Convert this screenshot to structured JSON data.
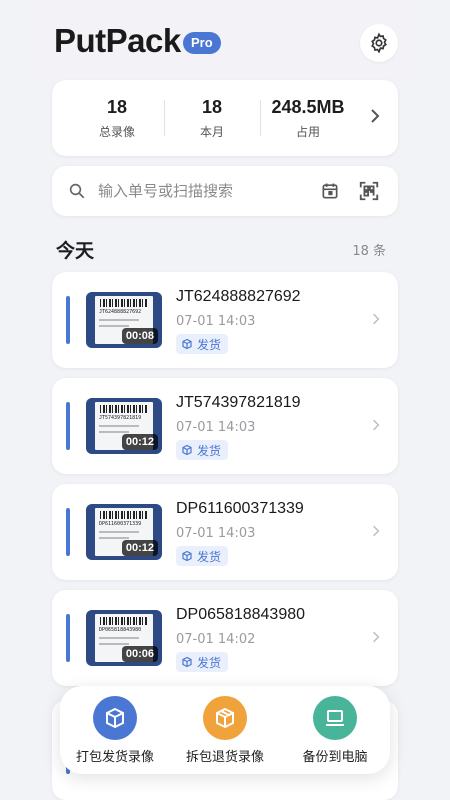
{
  "app": {
    "title": "PutPack",
    "badge": "Pro"
  },
  "icons": {
    "settings": "gear-icon",
    "search": "search-icon",
    "calendar": "calendar-icon",
    "scan": "scan-icon",
    "chevron": "chevron-right-icon",
    "tag": "box-icon"
  },
  "colors": {
    "accent": "#4a76d4",
    "orange": "#f0a23b",
    "teal": "#48b49a"
  },
  "stats": [
    {
      "value": "18",
      "label": "总录像"
    },
    {
      "value": "18",
      "label": "本月"
    },
    {
      "value": "248.5MB",
      "label": "占用"
    }
  ],
  "search": {
    "placeholder": "输入单号或扫描搜索"
  },
  "section": {
    "title": "今天",
    "count": "18 条"
  },
  "records": [
    {
      "tracking": "JT624888827692",
      "datetime": "07-01 14:03",
      "tag": "发货",
      "duration": "00:08",
      "thumb_text": "JT624888827692"
    },
    {
      "tracking": "JT574397821819",
      "datetime": "07-01 14:03",
      "tag": "发货",
      "duration": "00:12",
      "thumb_text": "JT574397821819"
    },
    {
      "tracking": "DP611600371339",
      "datetime": "07-01 14:03",
      "tag": "发货",
      "duration": "00:12",
      "thumb_text": "DP611600371339"
    },
    {
      "tracking": "DP065818843980",
      "datetime": "07-01 14:02",
      "tag": "发货",
      "duration": "00:06",
      "thumb_text": "DP065818843980"
    }
  ],
  "actions": [
    {
      "label": "打包发货录像",
      "color": "#4a76d4"
    },
    {
      "label": "拆包退货录像",
      "color": "#f0a23b"
    },
    {
      "label": "备份到电脑",
      "color": "#48b49a"
    }
  ]
}
